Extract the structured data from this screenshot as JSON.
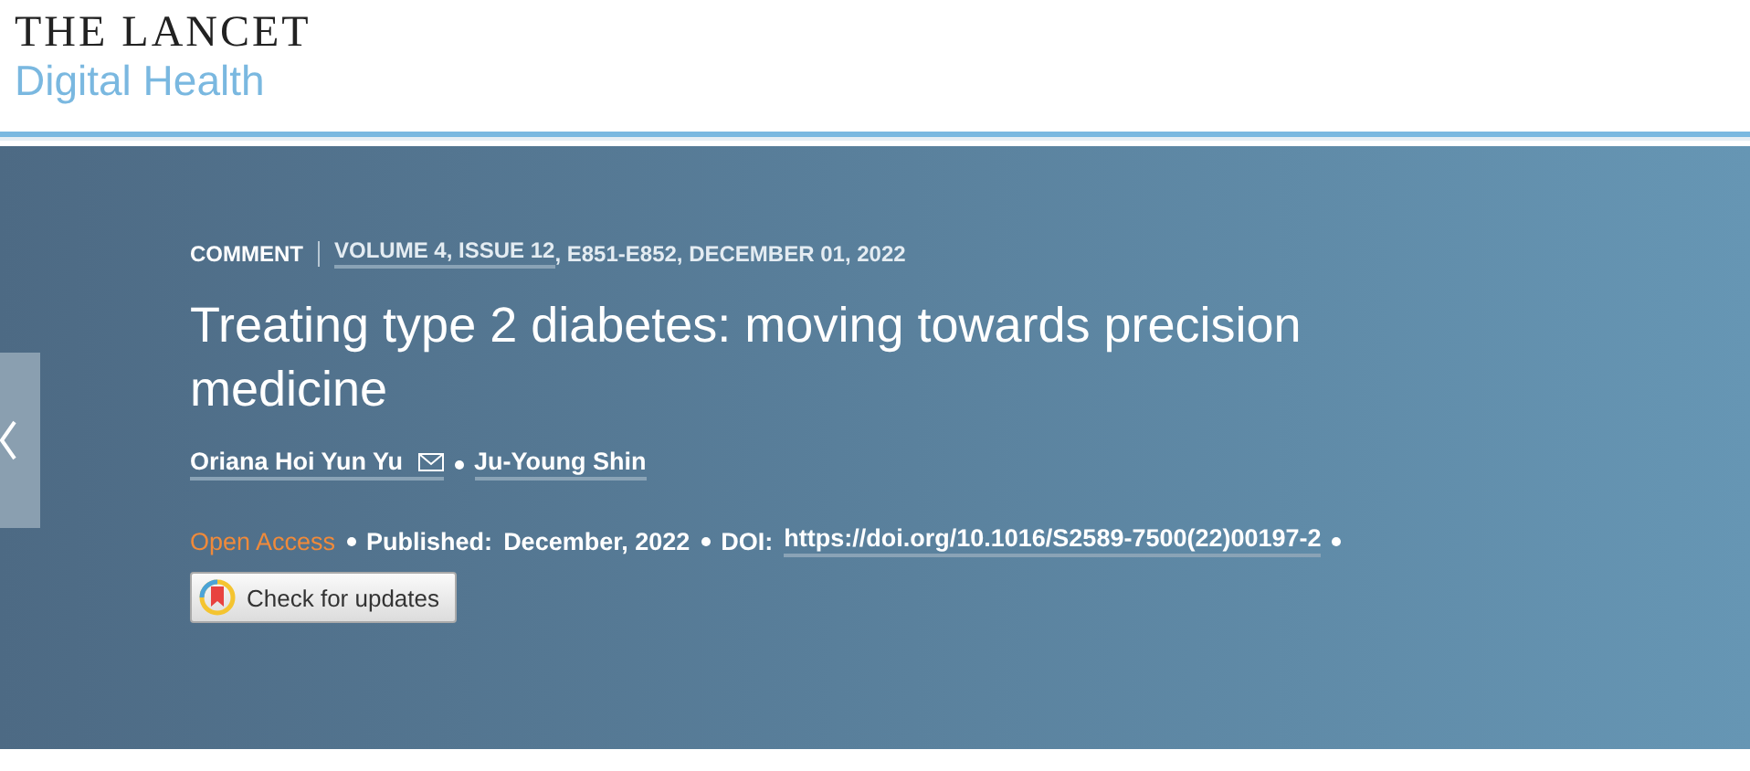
{
  "header": {
    "logo_title": "THE LANCET",
    "logo_subtitle": "Digital Health"
  },
  "article": {
    "type": "COMMENT",
    "issue_link": "VOLUME 4, ISSUE 12",
    "issue_rest": ", E851-E852, DECEMBER 01, 2022",
    "title": "Treating type 2 diabetes: moving towards precision medicine",
    "authors": [
      {
        "name": "Oriana Hoi Yun Yu",
        "email": true
      },
      {
        "name": "Ju-Young Shin",
        "email": false
      }
    ],
    "access": "Open Access",
    "published_label": "Published:",
    "published_date": "December, 2022",
    "doi_label": "DOI:",
    "doi": "https://doi.org/10.1016/S2589-7500(22)00197-2",
    "update_button": "Check for updates"
  }
}
